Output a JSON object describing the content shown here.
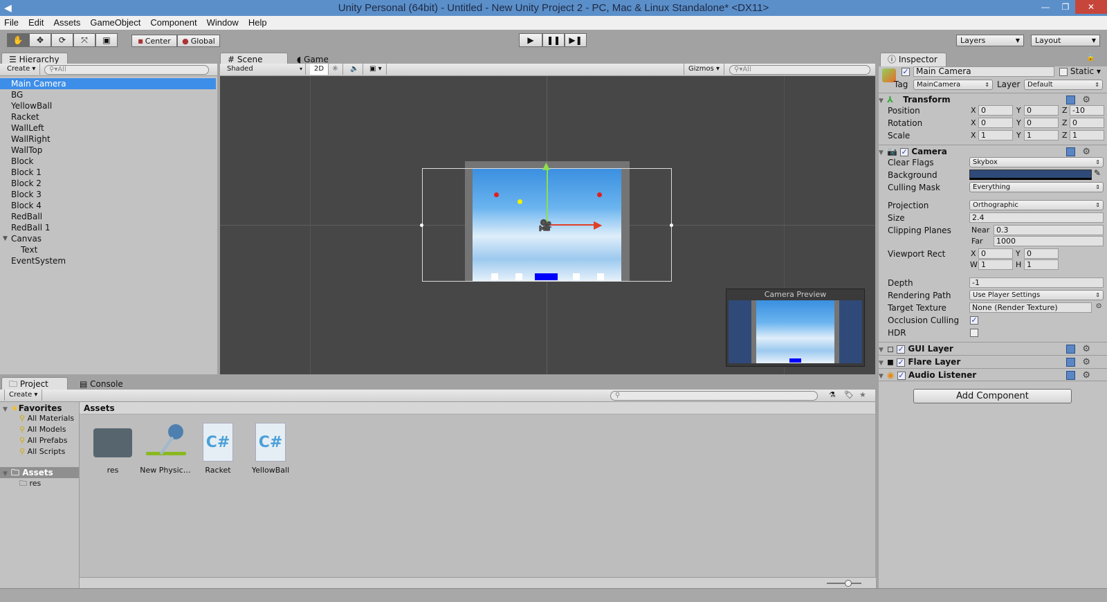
{
  "window": {
    "title": "Unity Personal (64bit) - Untitled - New Unity Project 2 - PC, Mac & Linux Standalone* <DX11>",
    "controls": [
      "minimize-icon",
      "restore-icon",
      "close-icon"
    ]
  },
  "menu": [
    "File",
    "Edit",
    "Assets",
    "GameObject",
    "Component",
    "Window",
    "Help"
  ],
  "toolbar": {
    "tools": [
      "hand-icon",
      "move-icon",
      "rotate-icon",
      "scale-icon",
      "rect-tool-icon"
    ],
    "pivot": "Center",
    "space": "Global",
    "play": [
      "play-icon",
      "pause-icon",
      "step-icon"
    ],
    "layers": "Layers",
    "layout": "Layout"
  },
  "hierarchy": {
    "tab": "Hierarchy",
    "create": "Create",
    "search_placeholder": "All",
    "items": [
      {
        "label": "Main Camera",
        "selected": true,
        "indent": 0
      },
      {
        "label": "BG",
        "indent": 0
      },
      {
        "label": "YellowBall",
        "indent": 0
      },
      {
        "label": "Racket",
        "indent": 0
      },
      {
        "label": "WallLeft",
        "indent": 0
      },
      {
        "label": "WallRight",
        "indent": 0
      },
      {
        "label": "WallTop",
        "indent": 0
      },
      {
        "label": "Block",
        "indent": 0
      },
      {
        "label": "Block 1",
        "indent": 0
      },
      {
        "label": "Block 2",
        "indent": 0
      },
      {
        "label": "Block 3",
        "indent": 0
      },
      {
        "label": "Block 4",
        "indent": 0
      },
      {
        "label": "RedBall",
        "indent": 0
      },
      {
        "label": "RedBall 1",
        "indent": 0
      },
      {
        "label": "Canvas",
        "indent": 0,
        "expanded": true
      },
      {
        "label": "Text",
        "indent": 1
      },
      {
        "label": "EventSystem",
        "indent": 0
      }
    ]
  },
  "scene": {
    "tabs": [
      "Scene",
      "Game"
    ],
    "shading": "Shaded",
    "mode2d": "2D",
    "gizmos": "Gizmos",
    "search_placeholder": "All",
    "camera_preview": "Camera Preview",
    "background_color": "#474747",
    "sky_color": "#5aa8e6",
    "racket_color": "#0000ff"
  },
  "inspector": {
    "tab": "Inspector",
    "object_name": "Main Camera",
    "active": true,
    "static_label": "Static",
    "tag_label": "Tag",
    "tag": "MainCamera",
    "layer_label": "Layer",
    "layer": "Default",
    "transform": {
      "title": "Transform",
      "rows": [
        {
          "label": "Position",
          "x": "0",
          "y": "0",
          "z": "-10"
        },
        {
          "label": "Rotation",
          "x": "0",
          "y": "0",
          "z": "0"
        },
        {
          "label": "Scale",
          "x": "1",
          "y": "1",
          "z": "1"
        }
      ]
    },
    "camera": {
      "title": "Camera",
      "clear_flags_label": "Clear Flags",
      "clear_flags": "Skybox",
      "background_label": "Background",
      "background_color": "#2f4a78",
      "culling_mask_label": "Culling Mask",
      "culling_mask": "Everything",
      "projection_label": "Projection",
      "projection": "Orthographic",
      "size_label": "Size",
      "size": "2.4",
      "clipping_label": "Clipping Planes",
      "near_label": "Near",
      "near": "0.3",
      "far_label": "Far",
      "far": "1000",
      "viewport_label": "Viewport Rect",
      "vx": "0",
      "vy": "0",
      "vw": "1",
      "vh": "1",
      "depth_label": "Depth",
      "depth": "-1",
      "rendering_label": "Rendering Path",
      "rendering": "Use Player Settings",
      "target_label": "Target Texture",
      "target": "None (Render Texture)",
      "occlusion_label": "Occlusion Culling",
      "occlusion": true,
      "hdr_label": "HDR",
      "hdr": false
    },
    "components": [
      "GUI Layer",
      "Flare Layer",
      "Audio Listener"
    ],
    "add_component": "Add Component",
    "axis": {
      "x": "X",
      "y": "Y",
      "z": "Z",
      "w": "W",
      "h": "H"
    }
  },
  "project": {
    "tabs": [
      "Project",
      "Console"
    ],
    "create": "Create",
    "favorites": "Favorites",
    "favorite_items": [
      "All Materials",
      "All Models",
      "All Prefabs",
      "All Scripts"
    ],
    "assets_root": "Assets",
    "asset_folders": [
      "res"
    ],
    "breadcrumb": "Assets",
    "assets": [
      {
        "name": "res",
        "icon": "folder-icon"
      },
      {
        "name": "New Physic…",
        "icon": "physics-material-icon"
      },
      {
        "name": "Racket",
        "icon": "csharp-script-icon"
      },
      {
        "name": "YellowBall",
        "icon": "csharp-script-icon"
      }
    ]
  }
}
